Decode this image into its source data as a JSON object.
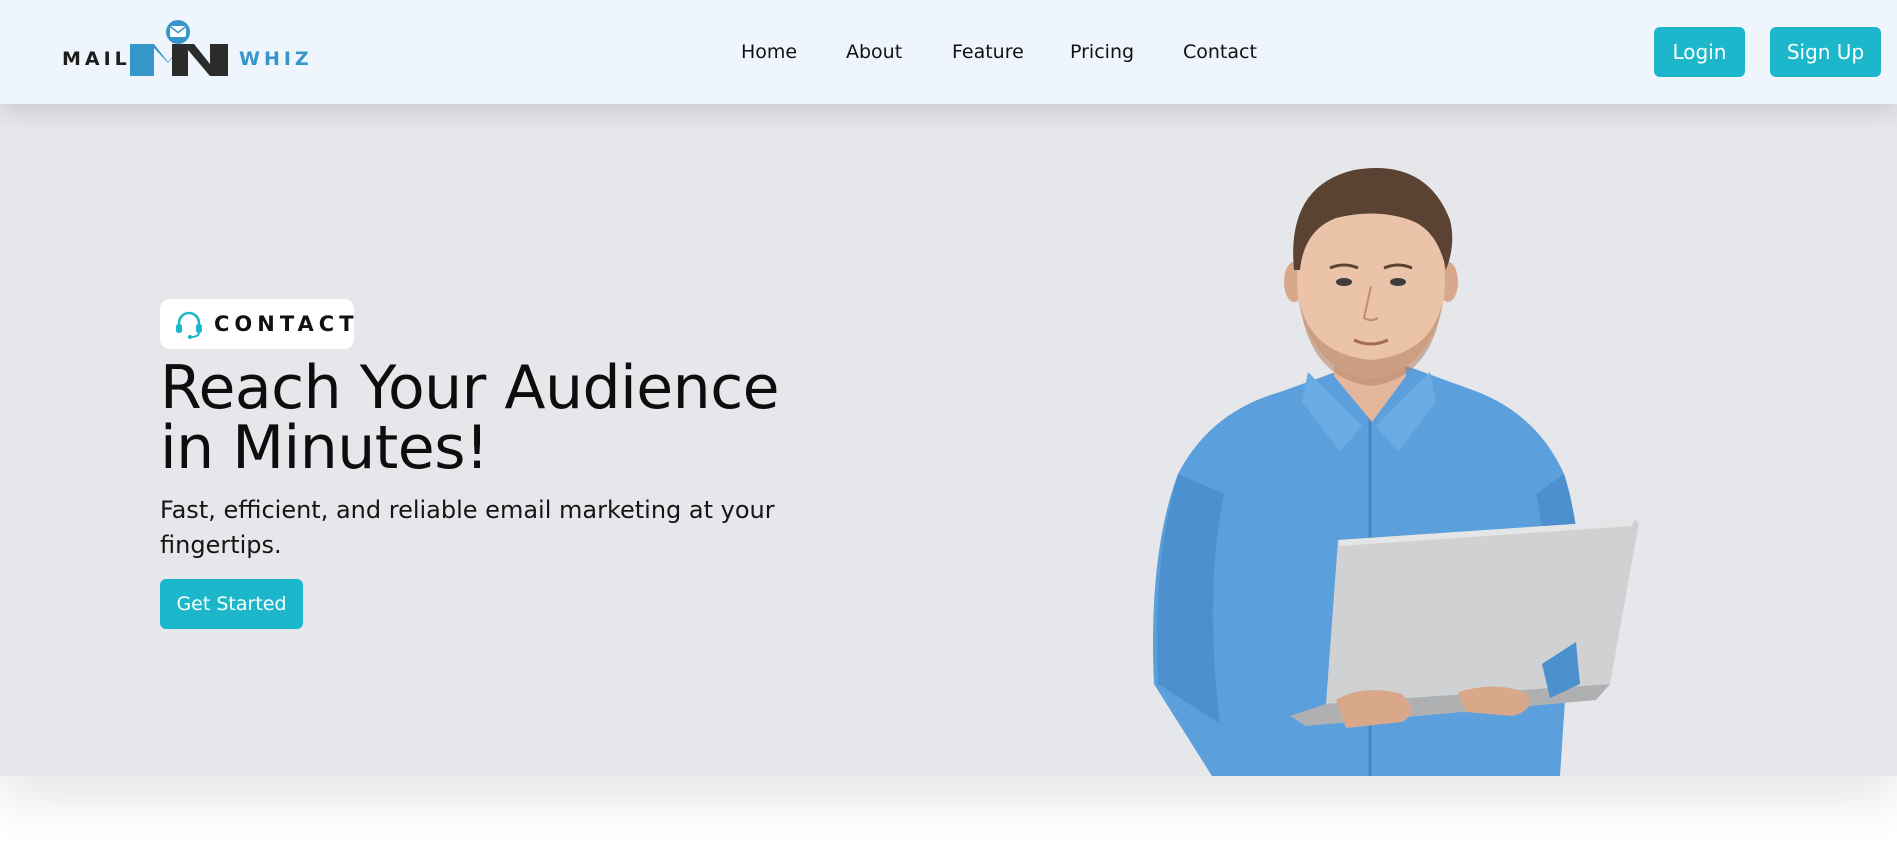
{
  "brand": {
    "left_word": "MAIL",
    "right_word": "WHIZ",
    "mark_icon": "envelope-m-logo-icon",
    "colors": {
      "blue": "#3796c9",
      "dark": "#2c2c2c"
    }
  },
  "nav": {
    "items": [
      {
        "label": "Home"
      },
      {
        "label": "About"
      },
      {
        "label": "Feature"
      },
      {
        "label": "Pricing"
      },
      {
        "label": "Contact"
      }
    ]
  },
  "auth": {
    "login_label": "Login",
    "signup_label": "Sign Up"
  },
  "hero": {
    "chip_icon": "headset-icon",
    "chip_label": "CONTACT",
    "headline_line1": "Reach Your Audience",
    "headline_line2": "in Minutes!",
    "subhead": "Fast, efficient, and reliable email marketing at your fingertips.",
    "cta_label": "Get Started",
    "image": "man-in-blue-shirt-holding-laptop"
  },
  "theme": {
    "accent": "#1cb7ca",
    "header_bg": "#eef5fd",
    "hero_bg": "#e6e7ea"
  }
}
